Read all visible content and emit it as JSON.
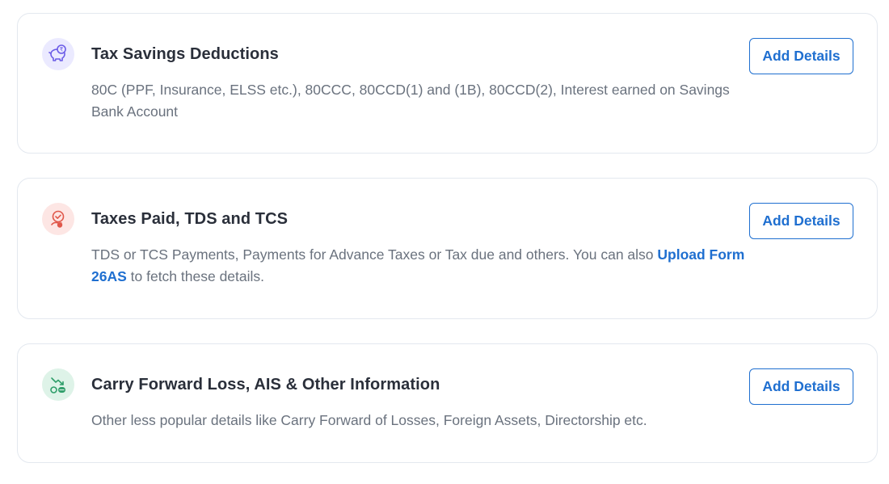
{
  "cards": [
    {
      "icon": "piggy-bank-rupee-icon",
      "title": "Tax Savings Deductions",
      "description": "80C (PPF, Insurance, ELSS etc.), 80CCC, 80CCD(1) and (1B), 80CCD(2), Interest earned on Savings Bank Account",
      "button_label": "Add Details"
    },
    {
      "icon": "tax-paid-check-icon",
      "title": "Taxes Paid, TDS and TCS",
      "description_before_link": "TDS or TCS Payments, Payments for Advance Taxes or Tax due and others. You can also ",
      "link_text": "Upload Form 26AS",
      "description_after_link": " to fetch these details.",
      "button_label": "Add Details"
    },
    {
      "icon": "carry-forward-loss-icon",
      "title": "Carry Forward Loss, AIS & Other Information",
      "description": "Other less popular details like Carry Forward of Losses, Foreign Assets, Directorship etc.",
      "button_label": "Add Details"
    }
  ],
  "colors": {
    "accent": "#1f6fd0",
    "title_text": "#2a2f3a",
    "description_text": "#6a727e",
    "card_border": "#e3e8ef",
    "icon_bg_purple": "#ebeaff",
    "icon_bg_red": "#fde6e4",
    "icon_bg_green": "#def3e8"
  }
}
